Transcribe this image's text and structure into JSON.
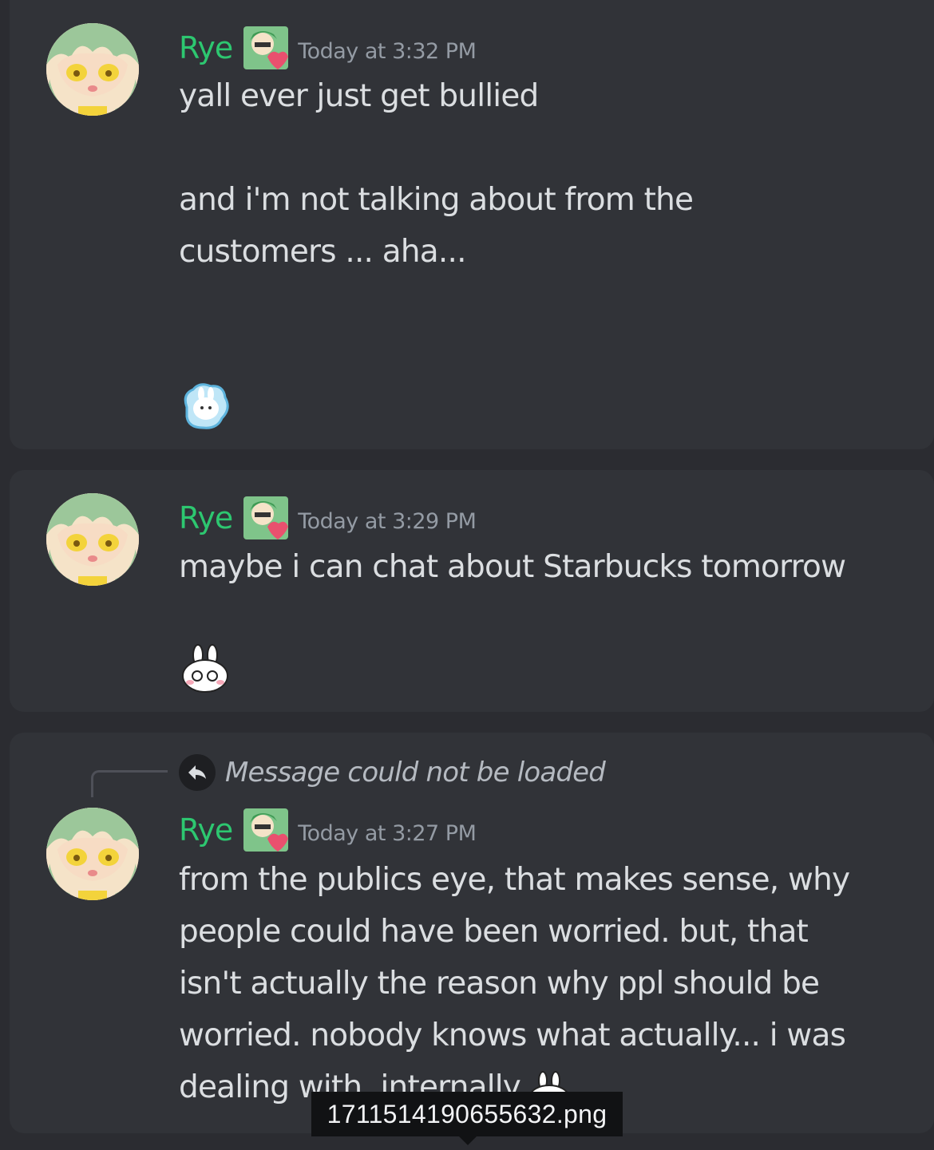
{
  "messages": [
    {
      "username": "Rye",
      "timestamp": "Today at 3:32 PM",
      "lines": [
        "yall ever just get bullied",
        "",
        "and i'm not talking about from the",
        "customers ... aha..."
      ],
      "emoji": "crying-bunny-cloud-emoji"
    },
    {
      "username": "Rye",
      "timestamp": "Today at 3:29 PM",
      "lines": [
        "maybe i can chat about Starbucks tomorrow"
      ],
      "emoji": "blushing-bunny-emoji"
    },
    {
      "reply_text": "Message could not be loaded",
      "username": "Rye",
      "timestamp": "Today at 3:27 PM",
      "lines": [
        "from the publics eye, that makes sense, why",
        "people could have been worried. but, that",
        "isn't actually the reason why ppl should be",
        "worried. nobody knows what actually... i was",
        "dealing with. internally"
      ],
      "emoji": "crying-bunny-emoji"
    }
  ],
  "tooltip": {
    "filename": "1711514190655632.png"
  },
  "colors": {
    "background": "#2b2c31",
    "card": "#313338",
    "username": "#2dc770",
    "timestamp": "#949ba4",
    "text": "#dbdee1",
    "tooltip_bg": "#111214"
  }
}
